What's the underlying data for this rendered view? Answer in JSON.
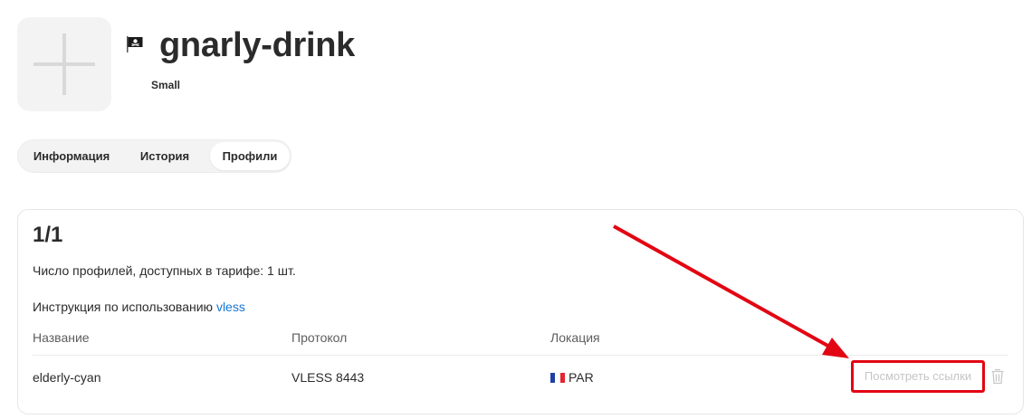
{
  "header": {
    "server_name": "gnarly-drink",
    "plan": "Small"
  },
  "tabs": [
    {
      "label": "Информация",
      "active": false
    },
    {
      "label": "История",
      "active": false
    },
    {
      "label": "Профили",
      "active": true
    }
  ],
  "profiles_card": {
    "count": "1/1",
    "limit_text": "Число профилей, доступных в тарифе: 1 шт.",
    "instruction_text": "Инструкция по использованию ",
    "instruction_link": "vless",
    "columns": [
      "Название",
      "Протокол",
      "Локация"
    ],
    "rows": [
      {
        "name": "elderly-cyan",
        "protocol": "VLESS 8443",
        "location": "PAR",
        "flag": "fr-flag-icon"
      }
    ],
    "view_links_label": "Посмотреть ссылки"
  },
  "icons": [
    "plus-icon",
    "pirate-flag-icon",
    "fr-flag-icon",
    "trash-icon"
  ],
  "colors": {
    "link": "#1677d2",
    "annotation_red": "#e20613",
    "tab_bg": "#f3f3f3",
    "disabled_text": "#c5c5c5"
  }
}
